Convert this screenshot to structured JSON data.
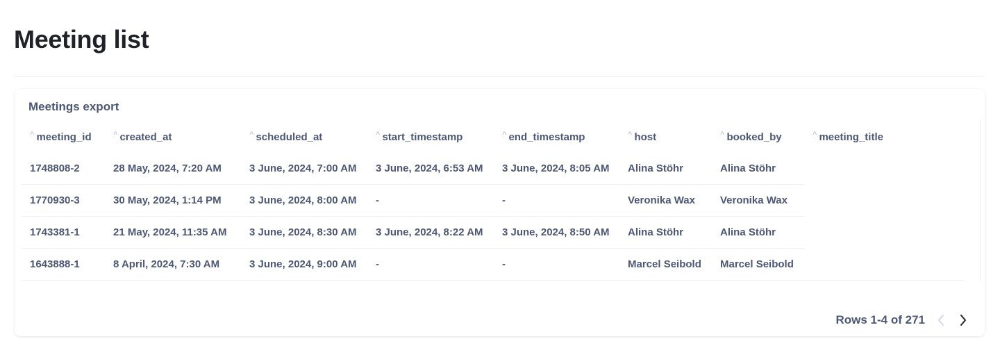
{
  "page": {
    "title": "Meeting list"
  },
  "card": {
    "title": "Meetings export"
  },
  "table": {
    "columns": [
      "meeting_id",
      "created_at",
      "scheduled_at",
      "start_timestamp",
      "end_timestamp",
      "host",
      "booked_by",
      "meeting_title"
    ],
    "rows": [
      [
        "1748808-2",
        "28 May, 2024, 7:20 AM",
        "3 June, 2024, 7:00 AM",
        "3 June, 2024, 6:53 AM",
        "3 June, 2024, 8:05 AM",
        "Alina Stöhr",
        "Alina Stöhr",
        ""
      ],
      [
        "1770930-3",
        "30 May, 2024, 1:14 PM",
        "3 June, 2024, 8:00 AM",
        "-",
        "-",
        "Veronika Wax",
        "Veronika Wax",
        ""
      ],
      [
        "1743381-1",
        "21 May, 2024, 11:35 AM",
        "3 June, 2024, 8:30 AM",
        "3 June, 2024, 8:22 AM",
        "3 June, 2024, 8:50 AM",
        "Alina Stöhr",
        "Alina Stöhr",
        ""
      ],
      [
        "1643888-1",
        "8 April, 2024, 7:30 AM",
        "3 June, 2024, 9:00 AM",
        "-",
        "-",
        "Marcel Seibold",
        "Marcel Seibold",
        ""
      ]
    ]
  },
  "pagination": {
    "label": "Rows 1-4 of 271",
    "prev_icon": "chevron-left-icon",
    "next_icon": "chevron-right-icon"
  },
  "colors": {
    "text": "#4c5773",
    "title": "#1f2328",
    "divider": "#eef0f3",
    "disabled": "#c5cbd4"
  }
}
